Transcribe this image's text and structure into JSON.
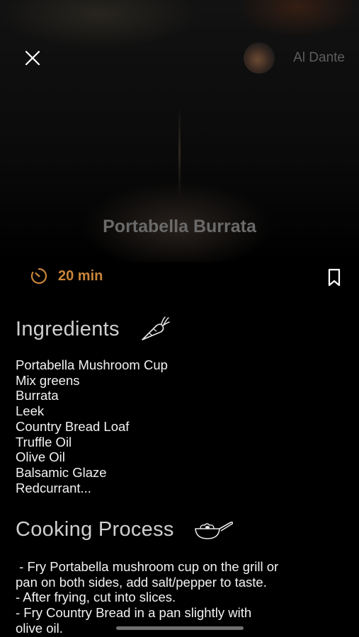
{
  "header": {
    "close_icon": "close-icon",
    "author_name": "Al Dante"
  },
  "recipe": {
    "title": "Portabella Burrata",
    "time": "20 min",
    "accent_color": "#c9853a"
  },
  "ingredients": {
    "title": "Ingredients",
    "icon": "carrot-icon",
    "items": [
      "Portabella Mushroom Cup",
      "Mix greens",
      "Burrata",
      "Leek",
      "Country Bread Loaf",
      "Truffle Oil",
      "Olive Oil",
      "Balsamic Glaze",
      "Redcurrant..."
    ]
  },
  "process": {
    "title": "Cooking Process",
    "icon": "frying-pan-icon",
    "lines": [
      " - Fry Portabella mushroom cup on the grill or",
      "pan on both sides, add salt/pepper to taste.",
      "- After frying, cut into slices.",
      "- Fry Country Bread in a pan slightly with",
      "olive oil."
    ]
  }
}
